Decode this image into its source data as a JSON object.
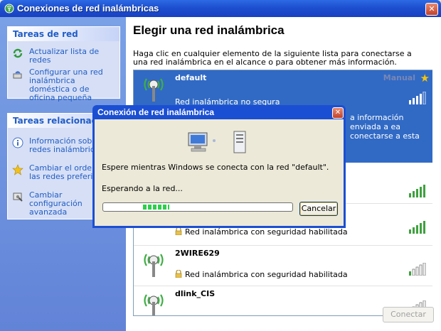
{
  "window": {
    "title": "Conexiones de red inalámbricas"
  },
  "sidebar": {
    "network_tasks": {
      "heading": "Tareas de red",
      "items": [
        {
          "label": "Actualizar lista de redes",
          "icon": "refresh-icon"
        },
        {
          "label": "Configurar una red inalámbrica doméstica o de oficina pequeña",
          "icon": "setup-icon"
        }
      ]
    },
    "related_tasks": {
      "heading": "Tareas relacionadas",
      "items": [
        {
          "label": "Información sobre redes inalámbricas",
          "icon": "info-icon"
        },
        {
          "label": "Cambiar el orden de las redes preferidas",
          "icon": "star-icon"
        },
        {
          "label": "Cambiar configuración avanzada",
          "icon": "settings-icon"
        }
      ]
    }
  },
  "main": {
    "title": "Elegir una red inalámbrica",
    "intro": "Haga clic en cualquier elemento de la siguiente lista para conectarse a una red inalámbrica en el alcance o para obtener más información.",
    "networks": [
      {
        "name": "default",
        "status": "Red inalámbrica no segura",
        "badge": "Manual",
        "signal_bars": 4,
        "selected": true,
        "detail": "a información enviada a ea conectarse a esta"
      },
      {
        "name": "",
        "status": "",
        "signal_bars": 5
      },
      {
        "name": "",
        "status": "Red inalámbrica con seguridad habilitada",
        "signal_bars": 5
      },
      {
        "name": "2WIRE629",
        "status": "Red inalámbrica con seguridad habilitada",
        "signal_bars": 1
      },
      {
        "name": "dlink_CIS",
        "status": "",
        "signal_bars": 1
      }
    ],
    "connect_label": "Conectar"
  },
  "dialog": {
    "title": "Conexión de red inalámbrica",
    "message": "Espere mientras Windows se conecta con la red \"default\".",
    "waiting": "Esperando a la red...",
    "cancel_label": "Cancelar",
    "progress": 0.25
  },
  "colors": {
    "title_blue": "#1d4fcf",
    "selection": "#316ac5",
    "link": "#215dc6",
    "signal": "#2ca02c"
  }
}
